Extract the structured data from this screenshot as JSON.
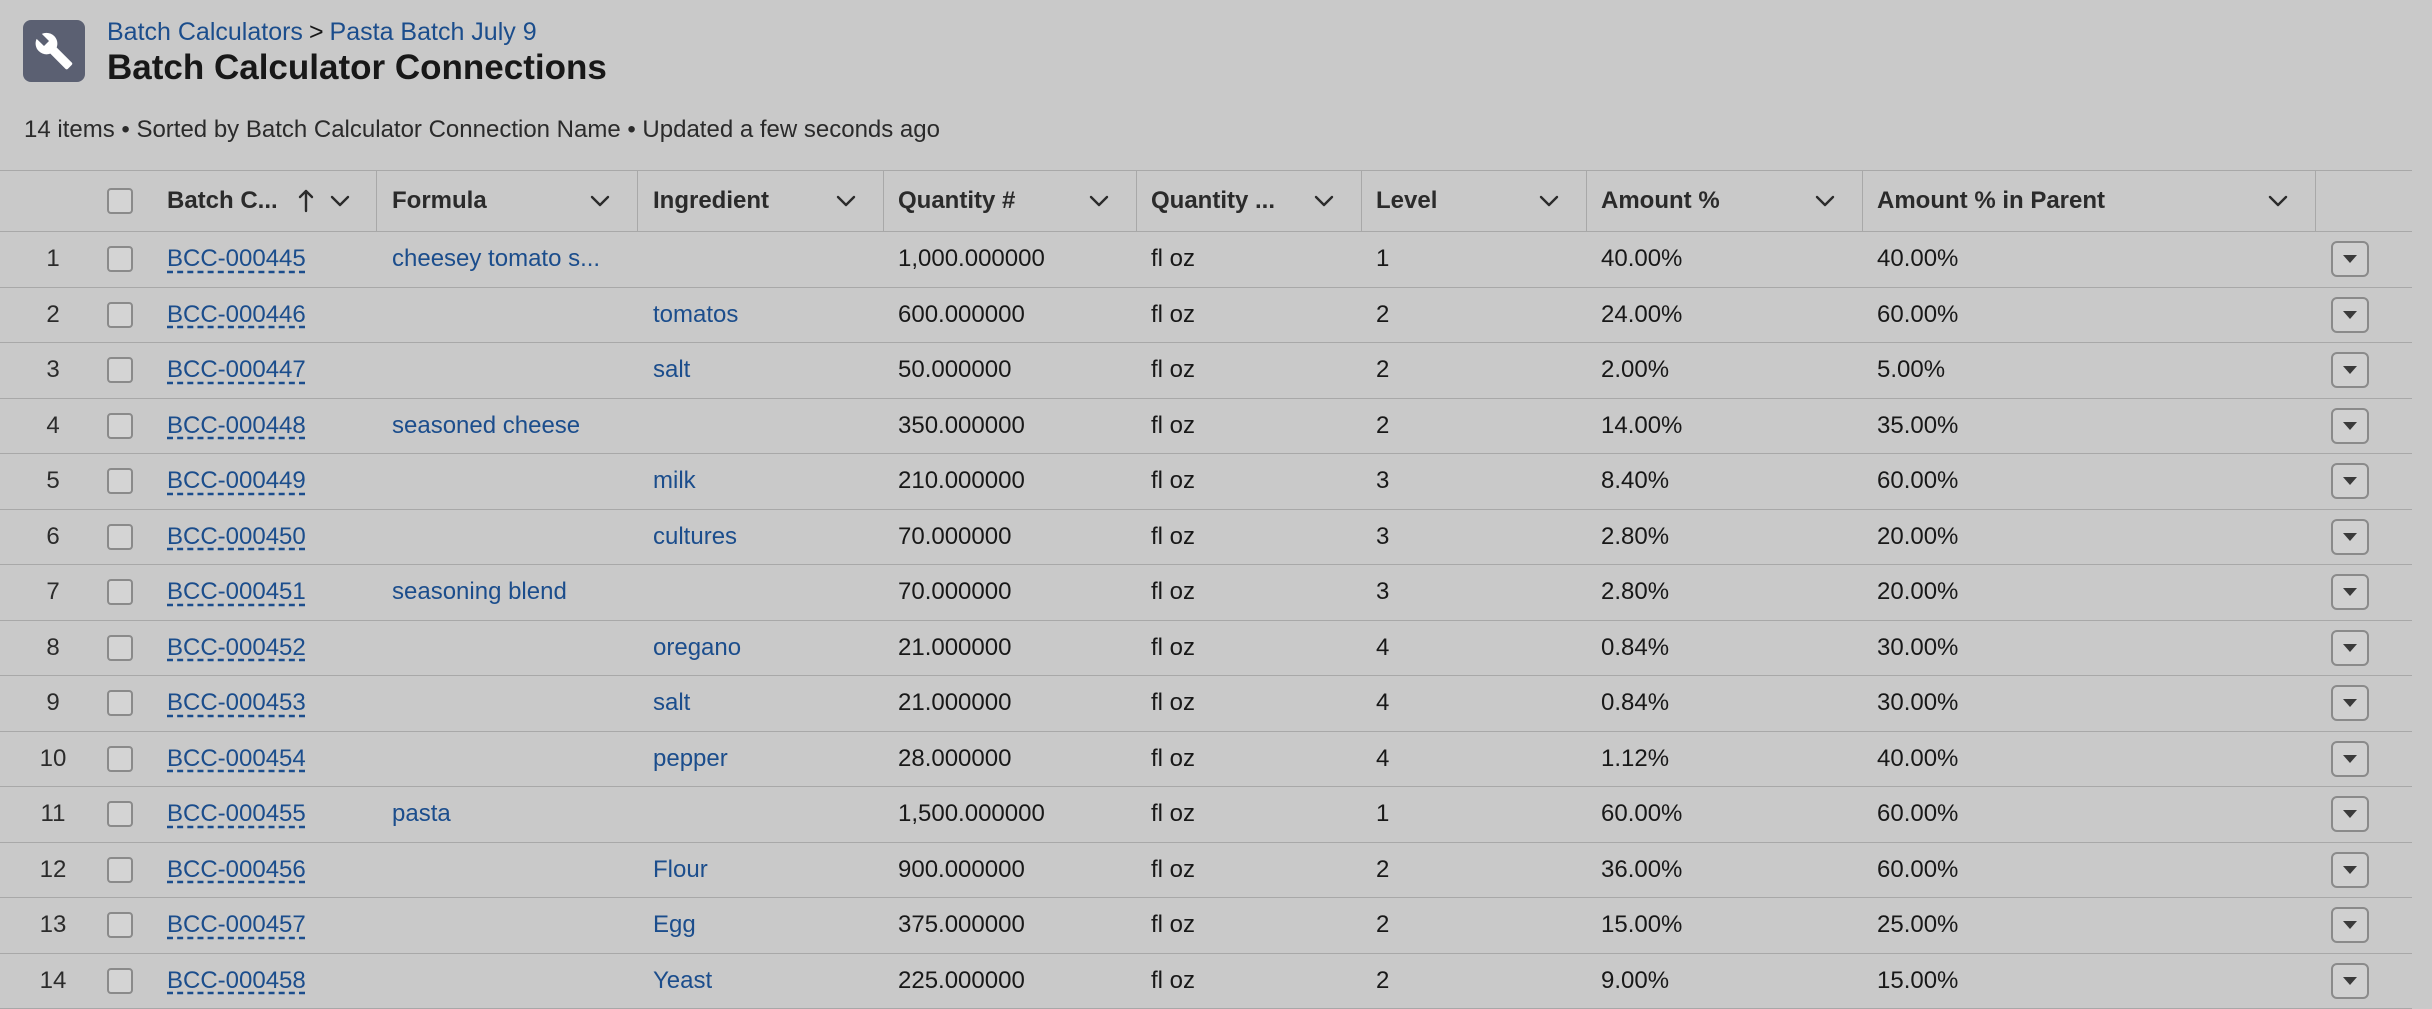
{
  "breadcrumb": {
    "parent": "Batch Calculators",
    "separator": ">",
    "current": "Pasta Batch July 9"
  },
  "page_title": "Batch Calculator Connections",
  "status_line": "14 items • Sorted by Batch Calculator Connection Name • Updated a few seconds ago",
  "icons": {
    "app": "wrench-icon",
    "sort": "arrow-up-icon",
    "column_menu": "chevron-down-icon",
    "row_menu": "triangle-down-icon"
  },
  "colors": {
    "link": "#1b4d8c",
    "app_icon_bg": "#5b6072"
  },
  "columns": [
    "Batch C...",
    "Formula",
    "Ingredient",
    "Quantity #",
    "Quantity ...",
    "Level",
    "Amount %",
    "Amount % in Parent"
  ],
  "rows": [
    {
      "num": "1",
      "name": "BCC-000445",
      "formula": "cheesey tomato s...",
      "ingredient": "",
      "qty": "1,000.000000",
      "unit": "fl oz",
      "level": "1",
      "amount": "40.00%",
      "parent": "40.00%"
    },
    {
      "num": "2",
      "name": "BCC-000446",
      "formula": "",
      "ingredient": "tomatos",
      "qty": "600.000000",
      "unit": "fl oz",
      "level": "2",
      "amount": "24.00%",
      "parent": "60.00%"
    },
    {
      "num": "3",
      "name": "BCC-000447",
      "formula": "",
      "ingredient": "salt",
      "qty": "50.000000",
      "unit": "fl oz",
      "level": "2",
      "amount": "2.00%",
      "parent": "5.00%"
    },
    {
      "num": "4",
      "name": "BCC-000448",
      "formula": "seasoned cheese",
      "ingredient": "",
      "qty": "350.000000",
      "unit": "fl oz",
      "level": "2",
      "amount": "14.00%",
      "parent": "35.00%"
    },
    {
      "num": "5",
      "name": "BCC-000449",
      "formula": "",
      "ingredient": "milk",
      "qty": "210.000000",
      "unit": "fl oz",
      "level": "3",
      "amount": "8.40%",
      "parent": "60.00%"
    },
    {
      "num": "6",
      "name": "BCC-000450",
      "formula": "",
      "ingredient": "cultures",
      "qty": "70.000000",
      "unit": "fl oz",
      "level": "3",
      "amount": "2.80%",
      "parent": "20.00%"
    },
    {
      "num": "7",
      "name": "BCC-000451",
      "formula": "seasoning blend",
      "ingredient": "",
      "qty": "70.000000",
      "unit": "fl oz",
      "level": "3",
      "amount": "2.80%",
      "parent": "20.00%"
    },
    {
      "num": "8",
      "name": "BCC-000452",
      "formula": "",
      "ingredient": "oregano",
      "qty": "21.000000",
      "unit": "fl oz",
      "level": "4",
      "amount": "0.84%",
      "parent": "30.00%"
    },
    {
      "num": "9",
      "name": "BCC-000453",
      "formula": "",
      "ingredient": "salt",
      "qty": "21.000000",
      "unit": "fl oz",
      "level": "4",
      "amount": "0.84%",
      "parent": "30.00%"
    },
    {
      "num": "10",
      "name": "BCC-000454",
      "formula": "",
      "ingredient": "pepper",
      "qty": "28.000000",
      "unit": "fl oz",
      "level": "4",
      "amount": "1.12%",
      "parent": "40.00%"
    },
    {
      "num": "11",
      "name": "BCC-000455",
      "formula": "pasta",
      "ingredient": "",
      "qty": "1,500.000000",
      "unit": "fl oz",
      "level": "1",
      "amount": "60.00%",
      "parent": "60.00%"
    },
    {
      "num": "12",
      "name": "BCC-000456",
      "formula": "",
      "ingredient": "Flour",
      "qty": "900.000000",
      "unit": "fl oz",
      "level": "2",
      "amount": "36.00%",
      "parent": "60.00%"
    },
    {
      "num": "13",
      "name": "BCC-000457",
      "formula": "",
      "ingredient": "Egg",
      "qty": "375.000000",
      "unit": "fl oz",
      "level": "2",
      "amount": "15.00%",
      "parent": "25.00%"
    },
    {
      "num": "14",
      "name": "BCC-000458",
      "formula": "",
      "ingredient": "Yeast",
      "qty": "225.000000",
      "unit": "fl oz",
      "level": "2",
      "amount": "9.00%",
      "parent": "15.00%"
    }
  ]
}
